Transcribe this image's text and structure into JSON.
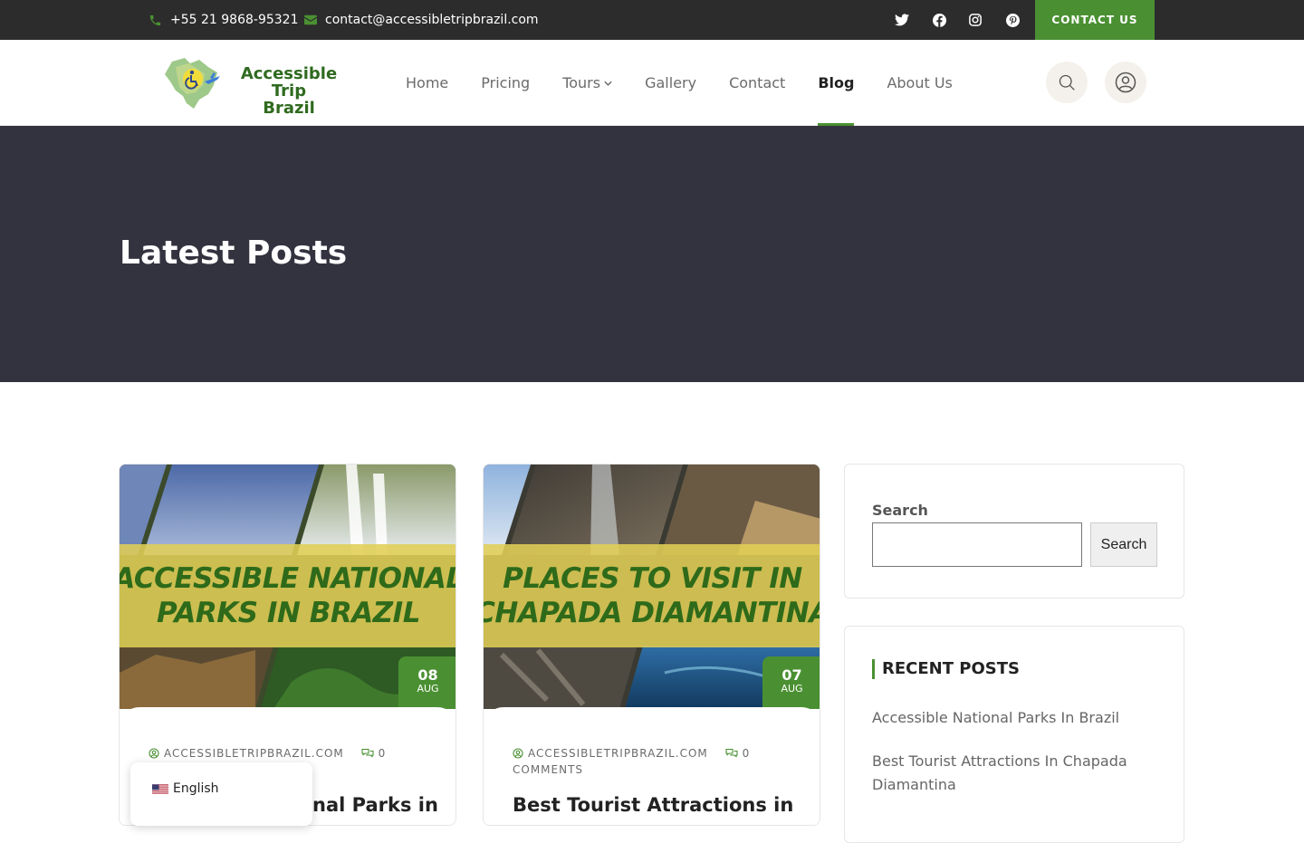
{
  "topbar": {
    "phone": "+55 21 9868-95321",
    "email": "contact@accessibletripbrazil.com",
    "social_icons": [
      "twitter-icon",
      "facebook-icon",
      "instagram-icon",
      "pinterest-icon"
    ],
    "cta_label": "CONTACT US"
  },
  "header": {
    "logo_text_line1": "Accessible Trip",
    "logo_text_line2": "Brazil",
    "nav": {
      "home": "Home",
      "pricing": "Pricing",
      "tours": "Tours",
      "gallery": "Gallery",
      "contact": "Contact",
      "blog": "Blog",
      "about": "About Us"
    },
    "active_nav": "Blog"
  },
  "hero": {
    "title": "Latest Posts"
  },
  "posts": [
    {
      "banner_line1": "Accessible National",
      "banner_line2": "Parks in Brazil",
      "day": "08",
      "month": "AUG",
      "author": "ACCESSIBLETRIPBRAZIL.COM",
      "comments": "0",
      "title_visible": "nal Parks in"
    },
    {
      "banner_line1": "Places to visit in",
      "banner_line2": "Chapada Diamantina",
      "day": "07",
      "month": "AUG",
      "author": "ACCESSIBLETRIPBRAZIL.COM",
      "comments": "0",
      "comments_word": "COMMENTS",
      "title_visible": "Best Tourist Attractions in"
    }
  ],
  "sidebar": {
    "search_label": "Search",
    "search_value": "",
    "search_button": "Search",
    "recent_title": "RECENT POSTS",
    "recent_posts": [
      "Accessible National Parks In Brazil",
      "Best Tourist Attractions In Chapada Diamantina"
    ]
  },
  "language": {
    "label": "English"
  },
  "colors": {
    "accent": "#4a9032",
    "hero_bg": "#33323f",
    "topbar_bg": "#2c2c2c",
    "banner": "#e0ce55"
  }
}
